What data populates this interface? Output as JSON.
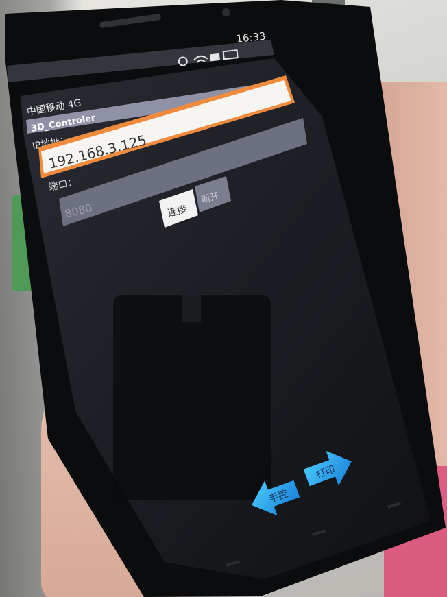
{
  "status_bar": {
    "carrier": "中国移动 4G",
    "time": "16:33"
  },
  "app": {
    "title": "3D_Controler",
    "ip_label": "IP地址：",
    "ip_value": "192.168.3.125",
    "port_label": "端口：",
    "port_value": "8080",
    "connect_button": "连接",
    "disconnect_button": "断开",
    "manual_button": "手控",
    "print_button": "打印"
  },
  "colors": {
    "accent_orange": "#f08a3c",
    "arrow_blue": "#22a9e8",
    "screen_dark": "#15171d"
  }
}
